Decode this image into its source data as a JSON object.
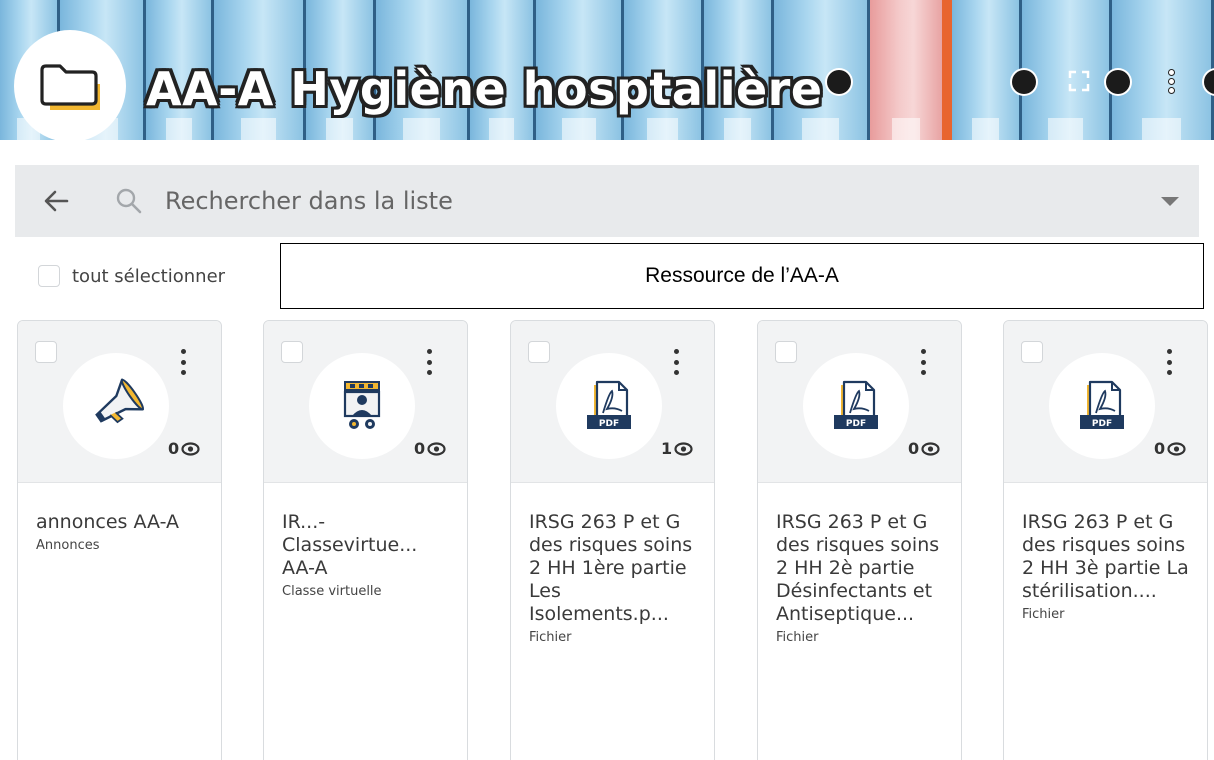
{
  "banner": {
    "title": "AA-A Hygiène hosptalière"
  },
  "search": {
    "placeholder": "Rechercher dans la liste"
  },
  "select_all": {
    "label": "tout sélectionner"
  },
  "resource_box": {
    "text": "Ressource de l’AA-A"
  },
  "cards": [
    {
      "name": "annonces AA-A",
      "type": "Annonces",
      "views": "0",
      "icon": "trumpet-icon"
    },
    {
      "name": "IR...-Classevirtue... AA-A",
      "type": "Classe virtuelle",
      "views": "0",
      "icon": "virtual-class-icon"
    },
    {
      "name": "IRSG 263 P et G des risques soins 2 HH 1ère partie Les Isolements.p...",
      "type": "Fichier",
      "views": "1",
      "icon": "pdf-icon"
    },
    {
      "name": "IRSG 263 P et G des risques soins 2 HH 2è partie Désinfectants et Antiseptique...",
      "type": "Fichier",
      "views": "0",
      "icon": "pdf-icon"
    },
    {
      "name": "IRSG 263 P et G des risques soins 2 HH 3è partie La stérilisation....",
      "type": "Fichier",
      "views": "0",
      "icon": "pdf-icon"
    }
  ],
  "colors": {
    "banner_blue": "#8fc8e8",
    "search_bg": "#e8eaec",
    "pdf_navy": "#1f3a5f",
    "accent_gold": "#f2b731"
  }
}
